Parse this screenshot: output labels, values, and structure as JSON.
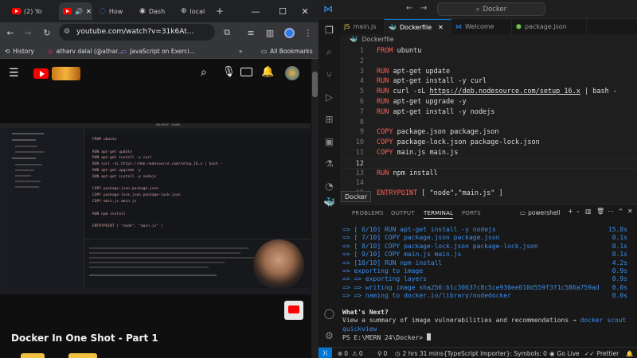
{
  "browser": {
    "tabs": [
      {
        "label": "(2) Yo"
      },
      {
        "label": ""
      },
      {
        "label": "How"
      },
      {
        "label": "Dash"
      },
      {
        "label": "local"
      }
    ],
    "new_tab": "+",
    "window": {
      "minimize": "—",
      "maximize": "☐",
      "close": "✕"
    },
    "url": "youtube.com/watch?v=31k6At...",
    "bookmarks": [
      {
        "label": "History"
      },
      {
        "label": "atharv dalal (@athar..."
      },
      {
        "label": "JavaScript on Exerci..."
      }
    ],
    "bookmarks_more": "»",
    "all_bookmarks": "All Bookmarks",
    "video_title": "Docker In One Shot - Part 1",
    "mini_editor": {
      "window_title": "docker node",
      "lines": [
        "FROM ubuntu",
        "",
        "RUN apt-get update",
        "RUN apt-get install -y curl",
        "RUN curl -sL https://deb.nodesource.com/setup_16.x | bash -",
        "RUN apt-get upgrade -y",
        "RUN apt-get install -y nodejs",
        "",
        "COPY package.json package.json",
        "COPY package-lock.json package-lock.json",
        "COPY main.js main.js",
        "",
        "RUN npm install",
        "",
        "ENTRYPOINT [ \"node\", \"main.js\" ]"
      ]
    }
  },
  "vscode": {
    "search": "Docker",
    "tabs": [
      {
        "label": "main.js",
        "active": false
      },
      {
        "label": "Dockerfile",
        "active": true
      },
      {
        "label": "Welcome",
        "active": false
      },
      {
        "label": "package.json",
        "active": false
      }
    ],
    "breadcrumb": "Dockerfile",
    "code_lines": [
      {
        "n": "1",
        "kw": "FROM",
        "rest": " ubuntu",
        "link": ""
      },
      {
        "n": "2",
        "kw": "",
        "rest": "",
        "link": ""
      },
      {
        "n": "3",
        "kw": "RUN",
        "rest": " apt-get update",
        "link": ""
      },
      {
        "n": "4",
        "kw": "RUN",
        "rest": " apt-get install -y curl",
        "link": ""
      },
      {
        "n": "5",
        "kw": "RUN",
        "rest": " curl -sL ",
        "link": "https://deb.nodesource.com/setup_16.x",
        "tail": " | bash -"
      },
      {
        "n": "6",
        "kw": "RUN",
        "rest": " apt-get upgrade -y",
        "link": ""
      },
      {
        "n": "7",
        "kw": "RUN",
        "rest": " apt-get install -y nodejs",
        "link": ""
      },
      {
        "n": "8",
        "kw": "",
        "rest": "",
        "link": ""
      },
      {
        "n": "9",
        "kw": "COPY",
        "rest": " package.json package.json",
        "link": ""
      },
      {
        "n": "10",
        "kw": "COPY",
        "rest": " package-lock.json package-lock.json",
        "link": ""
      },
      {
        "n": "11",
        "kw": "COPY",
        "rest": " main.js main.js",
        "link": ""
      },
      {
        "n": "12",
        "kw": "",
        "rest": "",
        "link": ""
      },
      {
        "n": "13",
        "kw": "RUN",
        "rest": " npm install",
        "link": ""
      },
      {
        "n": "14",
        "kw": "",
        "rest": "",
        "link": ""
      },
      {
        "n": "15",
        "kw": "ENTRYPOINT",
        "rest": " [ \"node\",\"main.js\" ]",
        "link": ""
      }
    ],
    "tooltip": "Docker",
    "panel_tabs": [
      "PROBLEMS",
      "OUTPUT",
      "TERMINAL",
      "PORTS"
    ],
    "terminal_name": "powershell",
    "terminal_lines": [
      {
        "text": "=> [ 6/10] RUN apt-get install -y nodejs",
        "time": "15.8s"
      },
      {
        "text": "=> [ 7/10] COPY package.json package.json",
        "time": "0.1s"
      },
      {
        "text": "=> [ 8/10] COPY package-lock.json package-lock.json",
        "time": "0.1s"
      },
      {
        "text": "=> [ 9/10] COPY main.js main.js",
        "time": "0.1s"
      },
      {
        "text": "=> [10/10] RUN npm install",
        "time": "4.2s"
      },
      {
        "text": "=> exporting to image",
        "time": "0.9s"
      },
      {
        "text": "=> => exporting layers",
        "time": "0.9s"
      },
      {
        "text": "=> => writing image sha256:b1c30637c8c5ce930ee010d559f3f1c586a759ad",
        "time": "0.0s"
      },
      {
        "text": "=> => naming to docker.io/library/nodedocker",
        "time": "0.0s"
      }
    ],
    "whats_next": "What's Next?",
    "summary_text": "  View a summary of image vulnerabilities and recommendations →",
    "summary_cmd": " docker scout",
    "summary_cmd2": "  quickview",
    "prompt": "PS E:\\MERN 24\\Docker> ",
    "status": {
      "errors": "0",
      "warnings": "0",
      "ports": "0",
      "time": "2 hrs 31 mins",
      "ts": "{TypeScript Importer}: Symbols: 0",
      "golive": "Go Live",
      "prettier": "Prettier"
    }
  }
}
